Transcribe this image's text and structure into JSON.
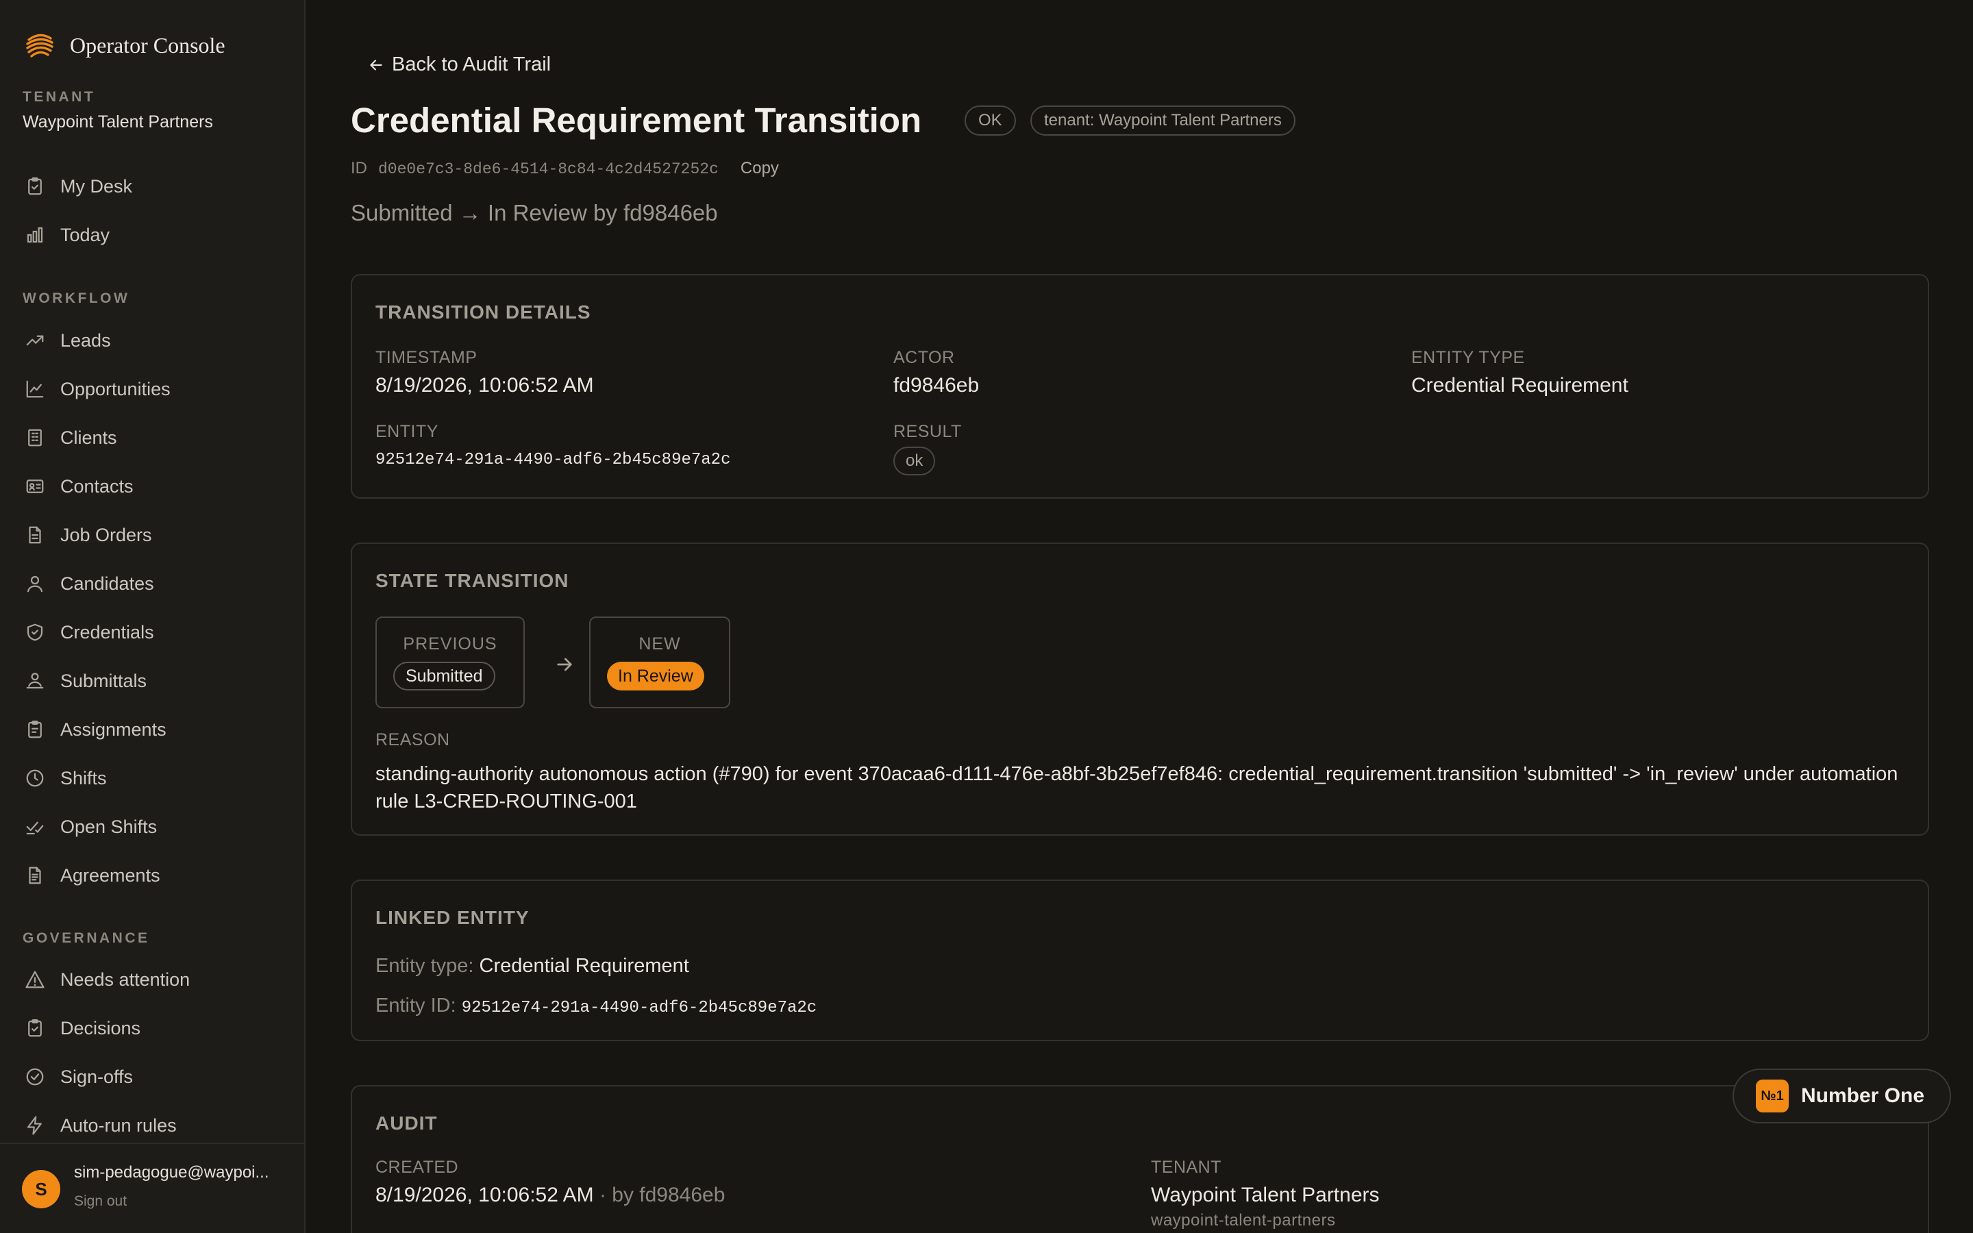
{
  "brand": {
    "name": "Operator Console"
  },
  "tenant": {
    "label": "TENANT",
    "name": "Waypoint Talent Partners"
  },
  "nav": {
    "top": [
      {
        "label": "My Desk",
        "icon": "clipboard-icon"
      },
      {
        "label": "Today",
        "icon": "bar-chart-icon"
      }
    ],
    "workflow_label": "WORKFLOW",
    "workflow": [
      {
        "label": "Leads",
        "icon": "trending-up-icon"
      },
      {
        "label": "Opportunities",
        "icon": "line-chart-icon"
      },
      {
        "label": "Clients",
        "icon": "building-icon"
      },
      {
        "label": "Contacts",
        "icon": "id-card-icon"
      },
      {
        "label": "Job Orders",
        "icon": "document-icon"
      },
      {
        "label": "Candidates",
        "icon": "user-icon"
      },
      {
        "label": "Credentials",
        "icon": "shield-icon"
      },
      {
        "label": "Submittals",
        "icon": "user-handoff-icon"
      },
      {
        "label": "Assignments",
        "icon": "clipboard-check-icon"
      },
      {
        "label": "Shifts",
        "icon": "clock-icon"
      },
      {
        "label": "Open Shifts",
        "icon": "check-slash-icon"
      },
      {
        "label": "Agreements",
        "icon": "document-text-icon"
      }
    ],
    "governance_label": "GOVERNANCE",
    "governance": [
      {
        "label": "Needs attention",
        "icon": "warning-icon"
      },
      {
        "label": "Decisions",
        "icon": "clipboard-icon"
      },
      {
        "label": "Sign-offs",
        "icon": "check-circle-icon"
      },
      {
        "label": "Auto-run rules",
        "icon": "lightning-icon"
      }
    ]
  },
  "user": {
    "initial": "S",
    "email": "sim-pedagogue@waypoi...",
    "signout": "Sign out"
  },
  "header": {
    "back": "Back to Audit Trail",
    "title": "Credential Requirement Transition",
    "status_pill": "OK",
    "tenant_pill": "tenant: Waypoint Talent Partners",
    "id_label": "ID",
    "id_value": "d0e0e7c3-8de6-4514-8c84-4c2d4527252c",
    "copy": "Copy",
    "subtitle": "Submitted → In Review by fd9846eb"
  },
  "transition_details": {
    "title": "TRANSITION DETAILS",
    "timestamp_label": "TIMESTAMP",
    "timestamp": "8/19/2026, 10:06:52 AM",
    "actor_label": "ACTOR",
    "actor": "fd9846eb",
    "entity_type_label": "ENTITY TYPE",
    "entity_type": "Credential Requirement",
    "entity_label": "ENTITY",
    "entity": "92512e74-291a-4490-adf6-2b45c89e7a2c",
    "result_label": "RESULT",
    "result": "ok"
  },
  "state_transition": {
    "title": "STATE TRANSITION",
    "previous_label": "PREVIOUS",
    "previous": "Submitted",
    "new_label": "NEW",
    "new": "In Review",
    "reason_label": "REASON",
    "reason": "standing-authority autonomous action (#790) for event 370acaa6-d111-476e-a8bf-3b25ef7ef846: credential_requirement.transition 'submitted' -> 'in_review' under automation rule L3-CRED-ROUTING-001"
  },
  "linked_entity": {
    "title": "LINKED ENTITY",
    "type_label": "Entity type:",
    "type": "Credential Requirement",
    "id_label": "Entity ID:",
    "id": "92512e74-291a-4490-adf6-2b45c89e7a2c"
  },
  "audit": {
    "title": "AUDIT",
    "created_label": "CREATED",
    "created": "8/19/2026, 10:06:52 AM",
    "created_by": "· by fd9846eb",
    "tenant_label": "TENANT",
    "tenant": "Waypoint Talent Partners",
    "tenant_slug": "waypoint-talent-partners"
  },
  "badge": {
    "icon_text": "№1",
    "label": "Number One"
  },
  "colors": {
    "accent": "#f28a16",
    "background": "#161512",
    "sidebar": "#1d1c19"
  }
}
